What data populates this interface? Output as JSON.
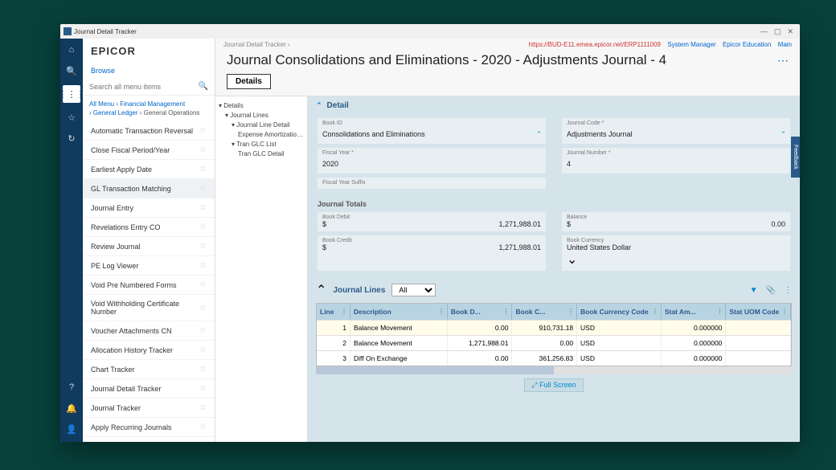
{
  "window_title": "Journal Detail Tracker",
  "logo": "EPICOR",
  "browse": "Browse",
  "search_placeholder": "Search all menu items",
  "crumbs": {
    "p1": "All Menu",
    "p2": "Financial Management",
    "p3": "General Ledger",
    "p4": "General Operations"
  },
  "menu": [
    "Automatic Transaction Reversal",
    "Close Fiscal Period/Year",
    "Earliest Apply Date",
    "GL Transaction Matching",
    "Journal Entry",
    "Revelations Entry CO",
    "Review Journal",
    "PE Log Viewer",
    "Void Pre Numbered Forms",
    "Void Withholding Certificate Number",
    "Voucher Attachments CN",
    "Allocation History Tracker",
    "Chart Tracker",
    "Journal Detail Tracker",
    "Journal Tracker",
    "Apply Recurring Journals"
  ],
  "top": {
    "bc": "Journal Detail Tracker  ›",
    "url": "https://BUD-E11.emea.epicor.net/ERP1111009",
    "mgr": "System Manager",
    "edu": "Epicor Education",
    "site": "Main"
  },
  "page_title": "Journal Consolidations and Eliminations - 2020 - Adjustments Journal - 4",
  "details_btn": "Details",
  "tree": {
    "n0": "Details",
    "n1": "Journal Lines",
    "n2": "Journal Line Detail",
    "n3": "Expense Amortization Sch",
    "n4": "Tran GLC List",
    "n5": "Tran GLC Detail"
  },
  "detail": {
    "hdr": "Detail",
    "book_id_lbl": "Book ID",
    "book_id": "Consolidations and Eliminations",
    "journal_code_lbl": "Journal Code *",
    "journal_code": "Adjustments Journal",
    "fy_lbl": "Fiscal Year *",
    "fy": "2020",
    "jn_lbl": "Journal Number *",
    "jn": "4",
    "fys_lbl": "Fiscal Year Suffix",
    "fys": ""
  },
  "totals": {
    "hdr": "Journal Totals",
    "debit_lbl": "Book Debit",
    "debit_cur": "$",
    "debit": "1,271,988.01",
    "balance_lbl": "Balance",
    "balance_cur": "$",
    "balance": "0.00",
    "credit_lbl": "Book Credit",
    "credit_cur": "$",
    "credit": "1,271,988.01",
    "curr_lbl": "Book Currency",
    "curr": "United States Dollar"
  },
  "jl": {
    "hdr": "Journal Lines",
    "filter": "All",
    "cols": [
      "Line",
      "Description",
      "Book D...",
      "Book C...",
      "Book Currency Code",
      "Stat Am...",
      "Stat UOM Code"
    ],
    "rows": [
      {
        "line": "1",
        "desc": "Balance Movement",
        "bd": "0.00",
        "bc": "910,731.18",
        "cur": "USD",
        "sa": "0.000000",
        "su": ""
      },
      {
        "line": "2",
        "desc": "Balance Movement",
        "bd": "1,271,988.01",
        "bc": "0.00",
        "cur": "USD",
        "sa": "0.000000",
        "su": ""
      },
      {
        "line": "3",
        "desc": "Diff On Exchange",
        "bd": "0.00",
        "bc": "361,256.83",
        "cur": "USD",
        "sa": "0.000000",
        "su": ""
      }
    ]
  },
  "fullscreen": "Full Screen",
  "feedback": "Feedback"
}
